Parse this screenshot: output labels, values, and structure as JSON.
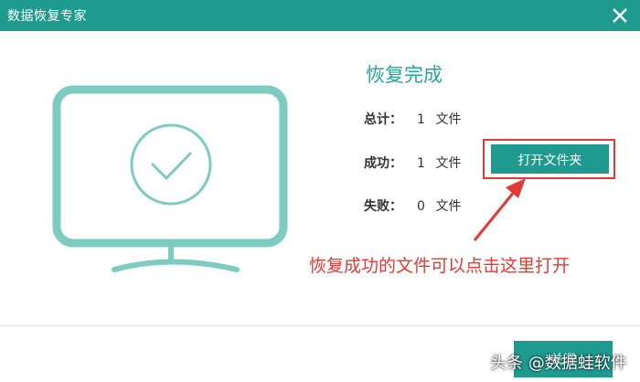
{
  "window": {
    "title": "数据恢复专家"
  },
  "result": {
    "heading": "恢复完成",
    "rows": [
      {
        "label": "总计：",
        "value": "1",
        "unit": "文件"
      },
      {
        "label": "成功：",
        "value": "1",
        "unit": "文件"
      },
      {
        "label": "失败：",
        "value": "0",
        "unit": "文件"
      }
    ]
  },
  "actions": {
    "open_folder": "打开文件夹",
    "close": "关闭"
  },
  "annotation": {
    "text": "恢复成功的文件可以点击这里打开"
  },
  "watermark": {
    "text": "头条 @数据蛙软件"
  },
  "colors": {
    "titlebar": "#1f9a8f",
    "accent": "#26a699",
    "monitor": "#7ecbc1",
    "annotation": "#e53935"
  },
  "icons": {
    "close": "close-icon",
    "monitor": "monitor-check-icon",
    "arrow": "annotation-arrow-icon"
  }
}
